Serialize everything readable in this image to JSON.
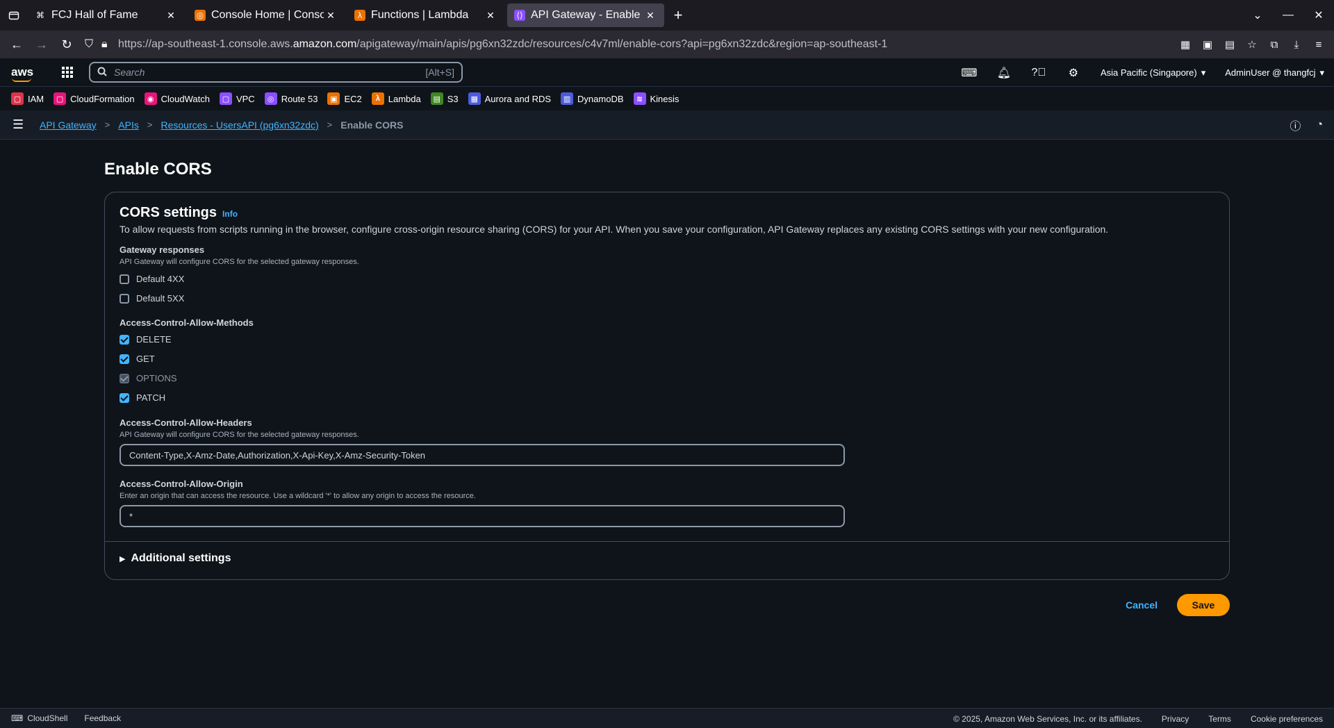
{
  "browser": {
    "tabs": [
      {
        "title": "FCJ Hall of Fame",
        "icon": "command-icon",
        "active": false
      },
      {
        "title": "Console Home | Console Home",
        "icon": "aws-console-icon",
        "active": false
      },
      {
        "title": "Functions | Lambda",
        "icon": "lambda-icon",
        "active": false
      },
      {
        "title": "API Gateway - Enable CORS",
        "icon": "api-gateway-icon",
        "active": true
      }
    ],
    "url_prefix": "https://ap-southeast-1.console.aws.",
    "url_host": "amazon.com",
    "url_suffix": "/apigateway/main/apis/pg6xn32zdc/resources/c4v7ml/enable-cors?api=pg6xn32zdc&region=ap-southeast-1"
  },
  "aws_nav": {
    "logo": "aws",
    "search_placeholder": "Search",
    "search_shortcut": "[Alt+S]",
    "region": "Asia Pacific (Singapore)",
    "user": "AdminUser @ thangfcj"
  },
  "favorites": [
    {
      "label": "IAM",
      "color": "#dd344c"
    },
    {
      "label": "CloudFormation",
      "color": "#e7157b"
    },
    {
      "label": "CloudWatch",
      "color": "#e7157b"
    },
    {
      "label": "VPC",
      "color": "#8c4fff"
    },
    {
      "label": "Route 53",
      "color": "#8c4fff"
    },
    {
      "label": "EC2",
      "color": "#ed7100"
    },
    {
      "label": "Lambda",
      "color": "#ed7100"
    },
    {
      "label": "S3",
      "color": "#3f8624"
    },
    {
      "label": "Aurora and RDS",
      "color": "#4d5bda"
    },
    {
      "label": "DynamoDB",
      "color": "#4d5bda"
    },
    {
      "label": "Kinesis",
      "color": "#8c4fff"
    }
  ],
  "breadcrumb": {
    "items": [
      "API Gateway",
      "APIs",
      "Resources - UsersAPI (pg6xn32zdc)"
    ],
    "current": "Enable CORS"
  },
  "page": {
    "title": "Enable CORS",
    "panel_title": "CORS settings",
    "info": "Info",
    "description": "To allow requests from scripts running in the browser, configure cross-origin resource sharing (CORS) for your API. When you save your configuration, API Gateway replaces any existing CORS settings with your new configuration.",
    "gateway_responses": {
      "label": "Gateway responses",
      "hint": "API Gateway will configure CORS for the selected gateway responses.",
      "options": [
        {
          "label": "Default 4XX",
          "checked": false
        },
        {
          "label": "Default 5XX",
          "checked": false
        }
      ]
    },
    "methods": {
      "label": "Access-Control-Allow-Methods",
      "options": [
        {
          "label": "DELETE",
          "checked": true,
          "disabled": false
        },
        {
          "label": "GET",
          "checked": true,
          "disabled": false
        },
        {
          "label": "OPTIONS",
          "checked": true,
          "disabled": true
        },
        {
          "label": "PATCH",
          "checked": true,
          "disabled": false
        }
      ]
    },
    "headers": {
      "label": "Access-Control-Allow-Headers",
      "hint": "API Gateway will configure CORS for the selected gateway responses.",
      "value": "Content-Type,X-Amz-Date,Authorization,X-Api-Key,X-Amz-Security-Token"
    },
    "origin": {
      "label": "Access-Control-Allow-Origin",
      "hint": "Enter an origin that can access the resource. Use a wildcard '*' to allow any origin to access the resource.",
      "value": "*"
    },
    "additional_settings": "Additional settings",
    "cancel": "Cancel",
    "save": "Save"
  },
  "footer": {
    "cloudshell": "CloudShell",
    "feedback": "Feedback",
    "copyright": "© 2025, Amazon Web Services, Inc. or its affiliates.",
    "privacy": "Privacy",
    "terms": "Terms",
    "cookies": "Cookie preferences"
  }
}
